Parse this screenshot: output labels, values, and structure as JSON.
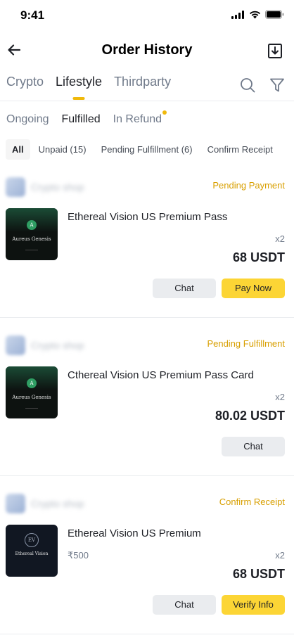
{
  "status_bar": {
    "time": "9:41"
  },
  "nav": {
    "title": "Order History"
  },
  "main_tabs": [
    {
      "label": "Crypto",
      "active": false
    },
    {
      "label": "Lifestyle",
      "active": true
    },
    {
      "label": "Thirdparty",
      "active": false
    }
  ],
  "sub_tabs": [
    {
      "label": "Ongoing",
      "active": false
    },
    {
      "label": "Fulfilled",
      "active": true
    },
    {
      "label": "In Refund",
      "active": false,
      "dot": true
    }
  ],
  "filter_chips": [
    {
      "label": "All",
      "active": true
    },
    {
      "label": "Unpaid (15)",
      "active": false
    },
    {
      "label": "Pending Fulfillment (6)",
      "active": false
    },
    {
      "label": "Confirm Receipt",
      "active": false
    }
  ],
  "orders": [
    {
      "shop_name": "Crypto shop",
      "status": "Pending Payment",
      "image_brand": "Aureus Genesis",
      "image_icon": "A",
      "title": "Ethereal Vision US Premium Pass",
      "price_sub": "",
      "qty": "x2",
      "total": "68 USDT",
      "actions": [
        "Chat",
        "Pay Now"
      ]
    },
    {
      "shop_name": "Crypto shop",
      "status": "Pending Fulfillment",
      "image_brand": "Aureus Genesis",
      "image_icon": "A",
      "title": "Cthereal Vision US Premium Pass Card",
      "price_sub": "",
      "qty": "x2",
      "total": "80.02 USDT",
      "actions": [
        "Chat"
      ]
    },
    {
      "shop_name": "Crypto shop",
      "status": "Confirm Receipt",
      "image_brand": "Ethereal Vision",
      "image_icon": "EV",
      "title": "Ethereal Vision US Premium",
      "price_sub": "₹500",
      "qty": "x2",
      "total": "68 USDT",
      "actions": [
        "Chat",
        "Verify Info"
      ]
    }
  ],
  "colors": {
    "accent": "#fcd535",
    "status": "#d89f00",
    "tab_indicator": "#f0b90b"
  },
  "icons": [
    "back-arrow-icon",
    "download-icon",
    "search-icon",
    "filter-icon",
    "signal-icon",
    "wifi-icon",
    "battery-icon"
  ]
}
